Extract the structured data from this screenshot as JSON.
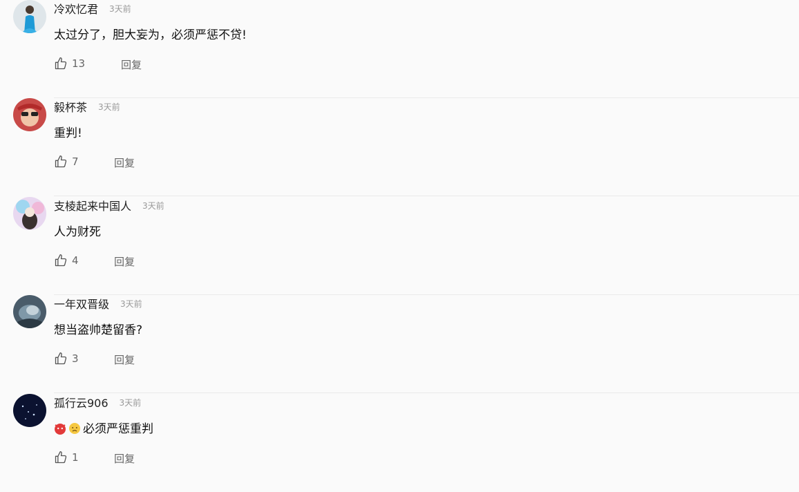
{
  "comments": [
    {
      "name": "冷欢忆君",
      "time": "3天前",
      "text": "太过分了，胆大妄为，必须严惩不贷!",
      "likes": "13",
      "reply": "回复"
    },
    {
      "name": "毅杯茶",
      "time": "3天前",
      "text": "重判!",
      "likes": "7",
      "reply": "回复"
    },
    {
      "name": "支棱起来中国人",
      "time": "3天前",
      "text": "人为财死",
      "likes": "4",
      "reply": "回复"
    },
    {
      "name": "一年双晋级",
      "time": "3天前",
      "text": "想当盗帅楚留香?",
      "likes": "3",
      "reply": "回复"
    },
    {
      "name": "孤行云906",
      "time": "3天前",
      "text": "必须严惩重判",
      "likes": "1",
      "reply": "回复",
      "emojis": [
        "angry-emoji",
        "sad-emoji"
      ]
    }
  ],
  "icons": {
    "like": "thumbs-up-icon"
  },
  "colors": {
    "time": "#999999",
    "action": "#666666",
    "divider": "#eaeaea"
  }
}
